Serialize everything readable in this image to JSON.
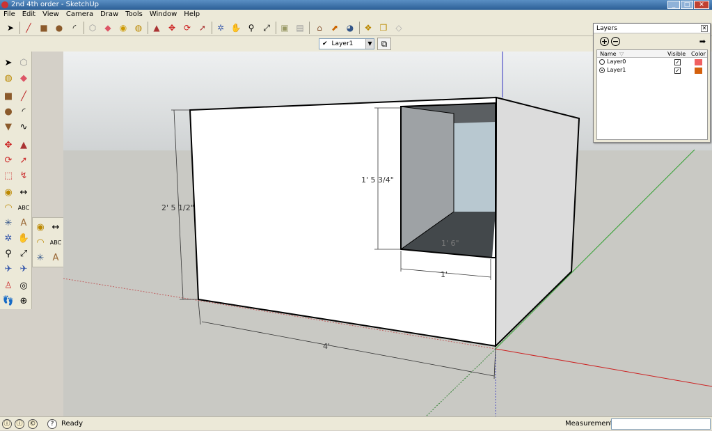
{
  "window": {
    "title": "2nd 4th order - SketchUp"
  },
  "menu": [
    "File",
    "Edit",
    "View",
    "Camera",
    "Draw",
    "Tools",
    "Window",
    "Help"
  ],
  "layer_toolbar": {
    "current_layer": "Layer1"
  },
  "status": {
    "text": "Ready",
    "measurements_label": "Measurements",
    "measurements_value": ""
  },
  "layers_panel": {
    "title": "Layers",
    "columns": {
      "name": "Name",
      "visible": "Visible",
      "color": "Color"
    },
    "layers": [
      {
        "name": "Layer0",
        "active": false,
        "visible": true,
        "color": "#f06060"
      },
      {
        "name": "Layer1",
        "active": true,
        "visible": true,
        "color": "#d4600c"
      }
    ]
  },
  "dimensions": {
    "height": "2' 5 1/2\"",
    "opening_height": "1' 5 3/4\"",
    "inner_depth": "1' 6\"",
    "opening_width": "1'",
    "width": "4'"
  },
  "colors": {
    "sky": "#d8dcde",
    "ground": "#c9c9c4",
    "face": "#ffffff",
    "side": "#dcdcdc",
    "interior_dark": "#555a5c"
  }
}
